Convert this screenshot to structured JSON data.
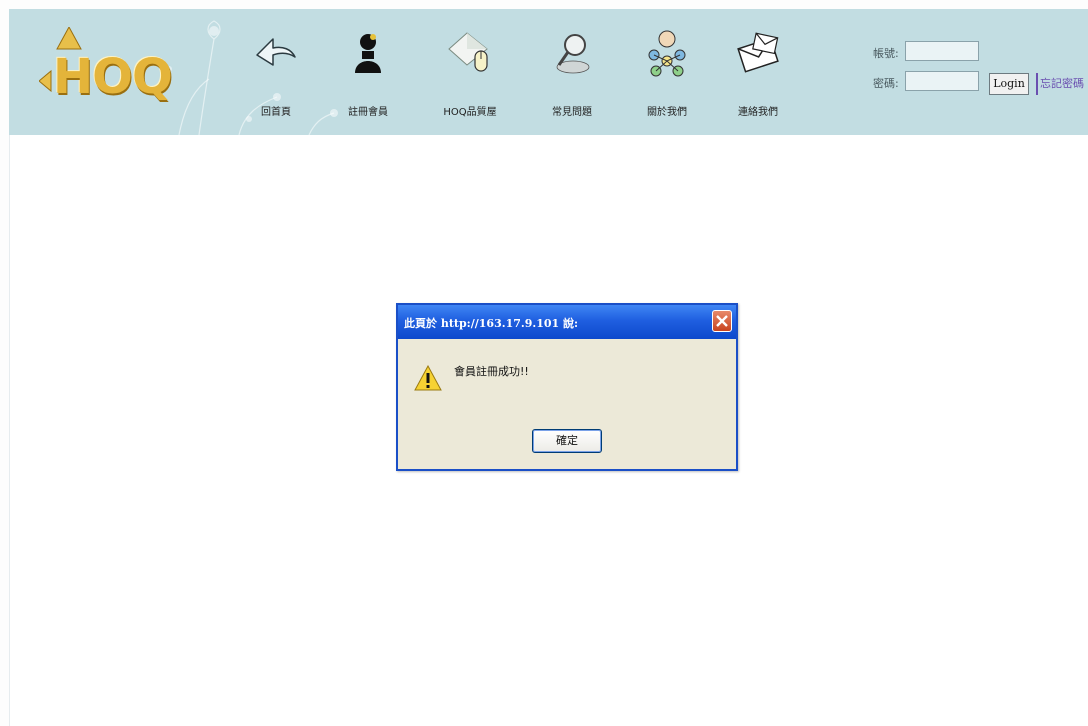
{
  "site": {
    "logo_text": "HOQ"
  },
  "nav": [
    {
      "label": "回首頁",
      "icon": "back-arrow-icon"
    },
    {
      "label": "註冊會員",
      "icon": "member-icon"
    },
    {
      "label": "HOQ品質屋",
      "icon": "house-mouse-icon"
    },
    {
      "label": "常見問題",
      "icon": "magnifier-icon"
    },
    {
      "label": "關於我們",
      "icon": "people-network-icon"
    },
    {
      "label": "連絡我們",
      "icon": "envelope-icon"
    }
  ],
  "login": {
    "account_label": "帳號:",
    "password_label": "密碼:",
    "account_value": "",
    "password_value": "",
    "login_button": "Login",
    "forgot_link": "忘記密碼"
  },
  "dialog": {
    "title": "此頁於 http://163.17.9.101 說:",
    "message": "會員註冊成功!!",
    "ok_button": "確定",
    "icon": "warning-icon"
  },
  "colors": {
    "header_bg": "#c2dde2",
    "dialog_border": "#1a4fc7",
    "dialog_bg": "#ece9d8",
    "logo_gold": "#e4b43a"
  }
}
